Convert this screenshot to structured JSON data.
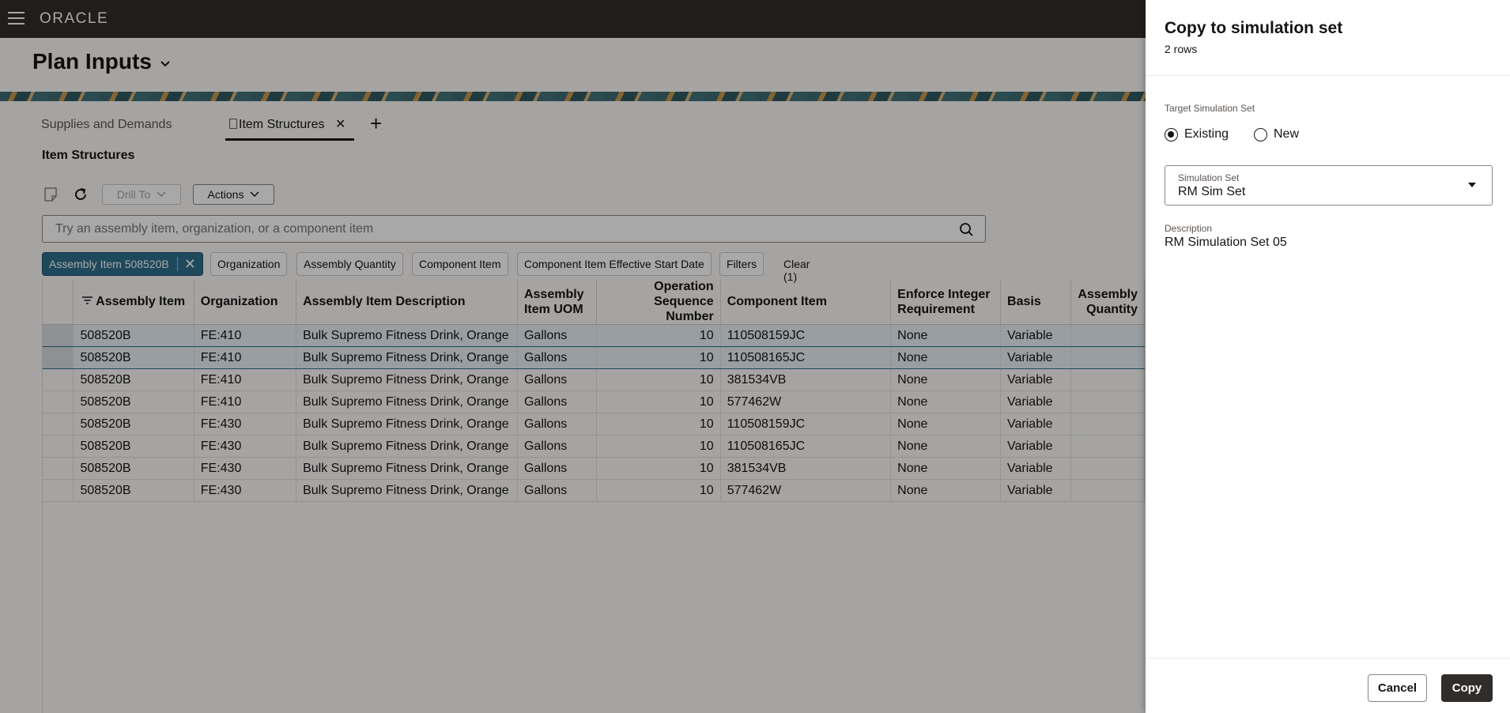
{
  "header": {
    "logo": "ORACLE"
  },
  "page": {
    "title": "Plan Inputs"
  },
  "tabs": [
    {
      "label": "Supplies and Demands"
    },
    {
      "label": "Item Structures"
    }
  ],
  "section": {
    "title": "Item Structures"
  },
  "toolbar": {
    "drill_to": "Drill To",
    "actions": "Actions"
  },
  "search": {
    "placeholder": "Try an assembly item, organization, or a component item"
  },
  "filters": {
    "active_chip": "Assembly Item 508520B",
    "chips": [
      "Organization",
      "Assembly Quantity",
      "Component Item",
      "Component Item Effective Start Date",
      "Filters"
    ],
    "clear": "Clear (1)"
  },
  "table": {
    "columns": [
      "Assembly Item",
      "Organization",
      "Assembly Item Description",
      "Assembly Item UOM",
      "Operation Sequence Number",
      "Component Item",
      "Enforce Integer Requirement",
      "Basis",
      "Assembly Quantity"
    ],
    "rows": [
      [
        "508520B",
        "FE:410",
        "Bulk Supremo Fitness Drink, Orange",
        "Gallons",
        "10",
        "110508159JC",
        "None",
        "Variable",
        ""
      ],
      [
        "508520B",
        "FE:410",
        "Bulk Supremo Fitness Drink, Orange",
        "Gallons",
        "10",
        "110508165JC",
        "None",
        "Variable",
        ""
      ],
      [
        "508520B",
        "FE:410",
        "Bulk Supremo Fitness Drink, Orange",
        "Gallons",
        "10",
        "381534VB",
        "None",
        "Variable",
        ""
      ],
      [
        "508520B",
        "FE:410",
        "Bulk Supremo Fitness Drink, Orange",
        "Gallons",
        "10",
        "577462W",
        "None",
        "Variable",
        ""
      ],
      [
        "508520B",
        "FE:430",
        "Bulk Supremo Fitness Drink, Orange",
        "Gallons",
        "10",
        "110508159JC",
        "None",
        "Variable",
        ""
      ],
      [
        "508520B",
        "FE:430",
        "Bulk Supremo Fitness Drink, Orange",
        "Gallons",
        "10",
        "110508165JC",
        "None",
        "Variable",
        ""
      ],
      [
        "508520B",
        "FE:430",
        "Bulk Supremo Fitness Drink, Orange",
        "Gallons",
        "10",
        "381534VB",
        "None",
        "Variable",
        ""
      ],
      [
        "508520B",
        "FE:430",
        "Bulk Supremo Fitness Drink, Orange",
        "Gallons",
        "10",
        "577462W",
        "None",
        "Variable",
        ""
      ]
    ],
    "selected_rows": [
      0,
      1
    ]
  },
  "drawer": {
    "title": "Copy to simulation set",
    "subtitle": "2 rows",
    "target_label": "Target Simulation Set",
    "radio_existing": "Existing",
    "radio_new": "New",
    "selected_target": "Existing",
    "simulation_set_label": "Simulation Set",
    "simulation_set_value": "RM Sim Set",
    "description_label": "Description",
    "description_value": "RM Simulation Set 05",
    "cancel": "Cancel",
    "copy": "Copy"
  }
}
